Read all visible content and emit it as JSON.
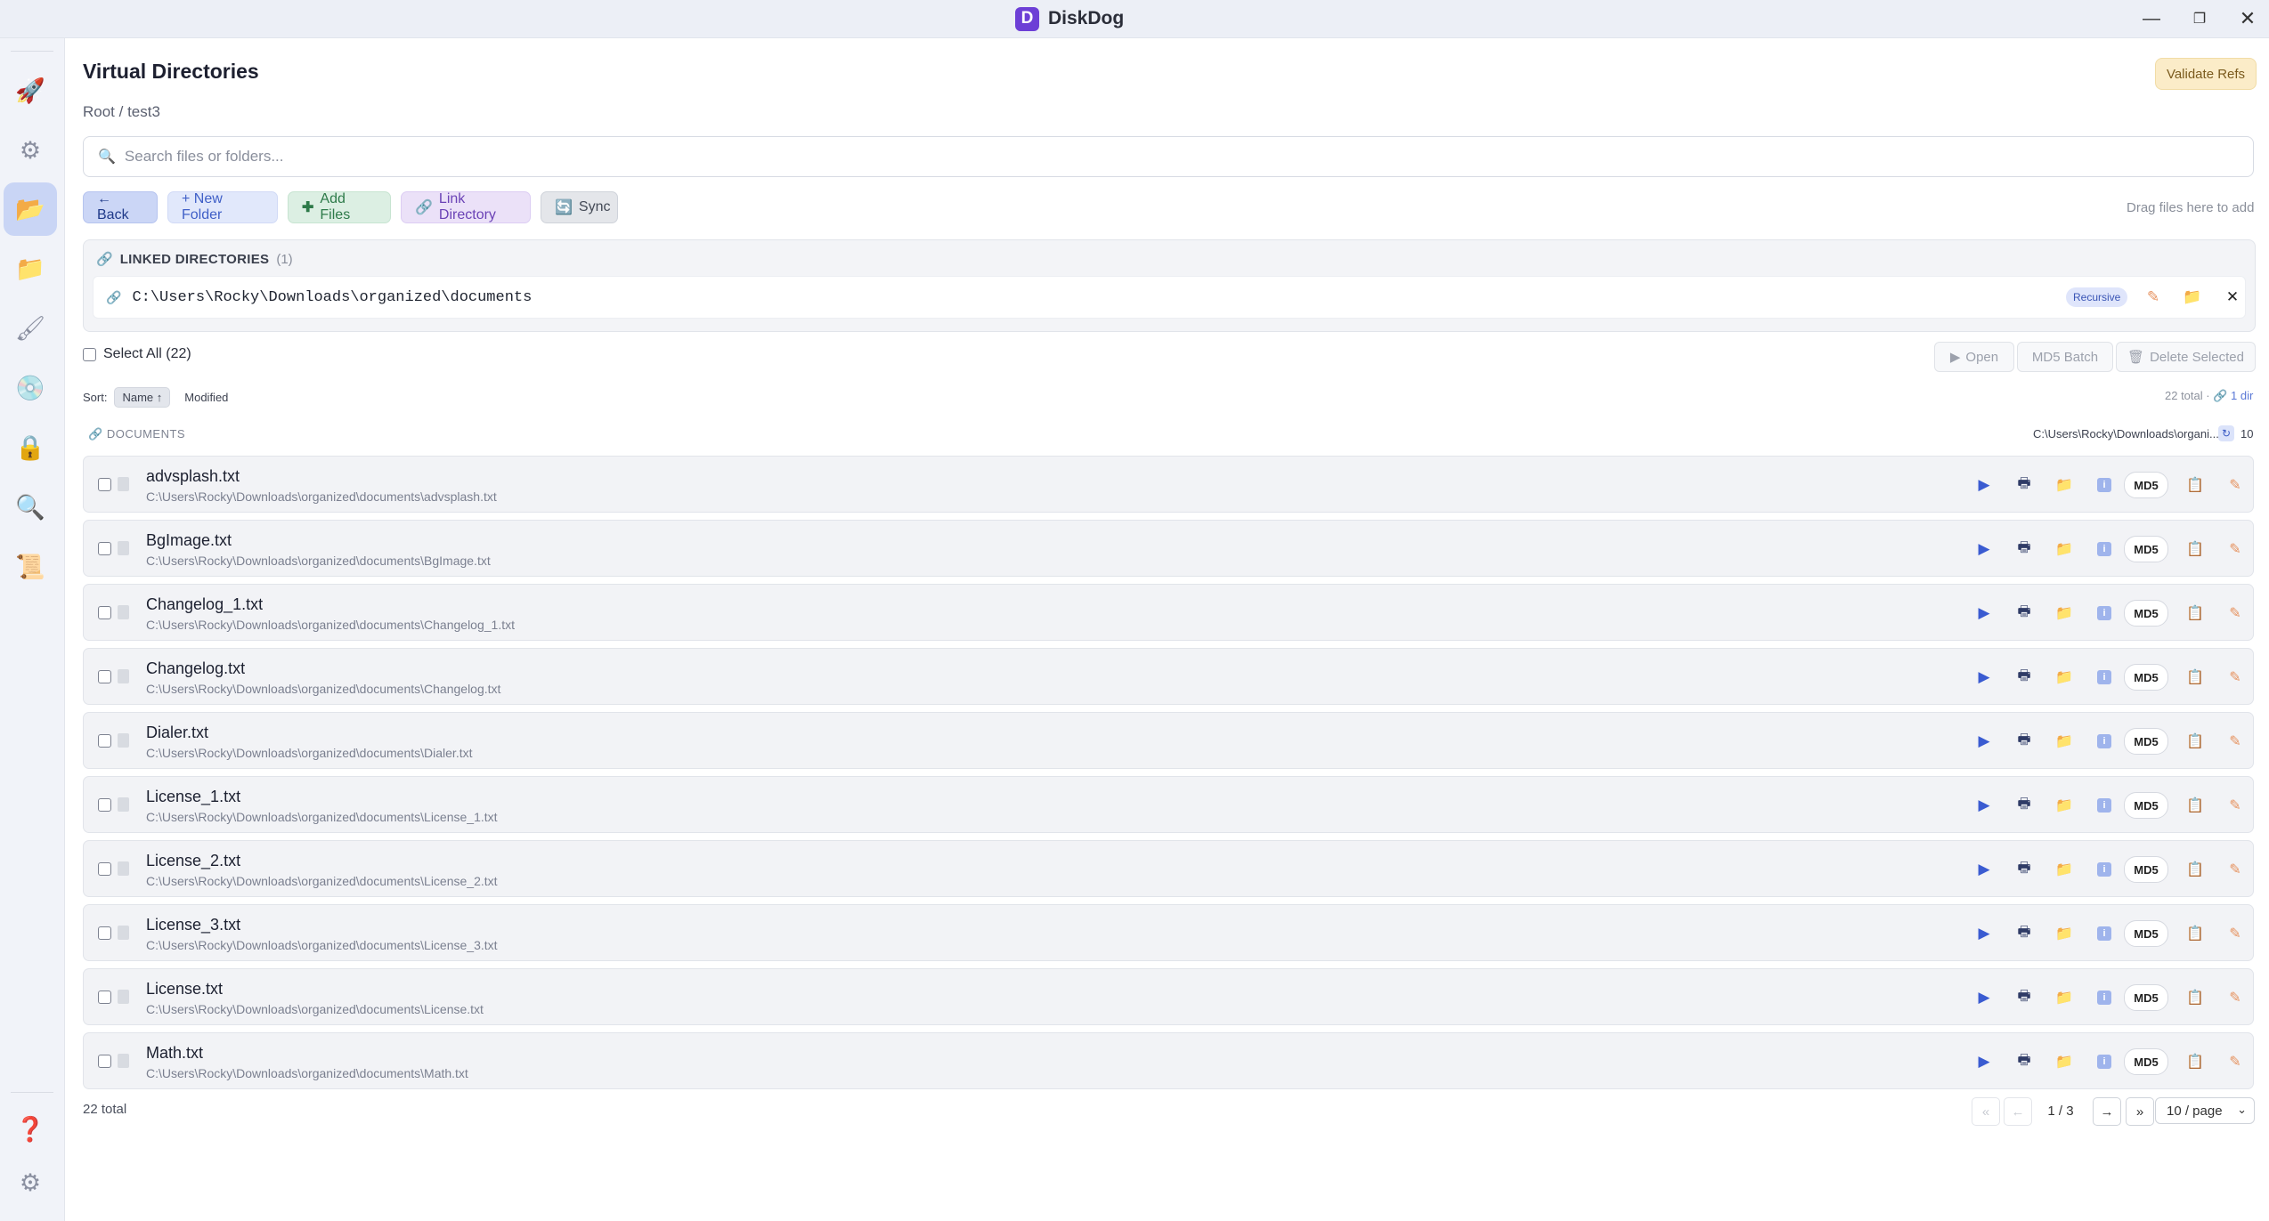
{
  "window": {
    "app_name": "DiskDog",
    "logo_letter": "D"
  },
  "rail": [
    "rocket-icon",
    "gear-icon",
    "folder-open-icon",
    "folder-icon",
    "brush-icon",
    "disc-icon",
    "lock-icon",
    "search-icon",
    "scroll-icon",
    "help-icon",
    "settings-icon"
  ],
  "page": {
    "title": "Virtual Directories",
    "validate_label": "Validate Refs",
    "breadcrumb": "Root / test3",
    "search_placeholder": "Search files or folders..."
  },
  "toolbar": {
    "back": "← Back",
    "new_folder": "+ New Folder",
    "add_files": "Add Files",
    "link_directory": "Link Directory",
    "sync": "Sync",
    "drag_hint": "Drag files here to add"
  },
  "linked": {
    "label": "LINKED DIRECTORIES",
    "count": "(1)",
    "path": "C:\\Users\\Rocky\\Downloads\\organized\\documents",
    "badge": "Recursive"
  },
  "selection": {
    "select_all": "Select All (22)",
    "open": "Open",
    "md5_batch": "MD5 Batch",
    "delete_selected": "Delete Selected"
  },
  "sort": {
    "label": "Sort:",
    "name": "Name ↑",
    "modified": "Modified",
    "total": "22 total",
    "dirs": "🔗 1 dir"
  },
  "group": {
    "label": "DOCUMENTS",
    "path": "C:\\Users\\Rocky\\Downloads\\organi...",
    "count": "10"
  },
  "files": [
    {
      "name": "advsplash.txt",
      "path": "C:\\Users\\Rocky\\Downloads\\organized\\documents\\advsplash.txt"
    },
    {
      "name": "BgImage.txt",
      "path": "C:\\Users\\Rocky\\Downloads\\organized\\documents\\BgImage.txt"
    },
    {
      "name": "Changelog_1.txt",
      "path": "C:\\Users\\Rocky\\Downloads\\organized\\documents\\Changelog_1.txt"
    },
    {
      "name": "Changelog.txt",
      "path": "C:\\Users\\Rocky\\Downloads\\organized\\documents\\Changelog.txt"
    },
    {
      "name": "Dialer.txt",
      "path": "C:\\Users\\Rocky\\Downloads\\organized\\documents\\Dialer.txt"
    },
    {
      "name": "License_1.txt",
      "path": "C:\\Users\\Rocky\\Downloads\\organized\\documents\\License_1.txt"
    },
    {
      "name": "License_2.txt",
      "path": "C:\\Users\\Rocky\\Downloads\\organized\\documents\\License_2.txt"
    },
    {
      "name": "License_3.txt",
      "path": "C:\\Users\\Rocky\\Downloads\\organized\\documents\\License_3.txt"
    },
    {
      "name": "License.txt",
      "path": "C:\\Users\\Rocky\\Downloads\\organized\\documents\\License.txt"
    },
    {
      "name": "Math.txt",
      "path": "C:\\Users\\Rocky\\Downloads\\organized\\documents\\Math.txt"
    }
  ],
  "md5_label": "MD5",
  "footer": {
    "total": "22 total",
    "first": "«",
    "prev": "←",
    "page": "1 / 3",
    "next": "→",
    "last": "»",
    "per_page": "10 / page"
  }
}
